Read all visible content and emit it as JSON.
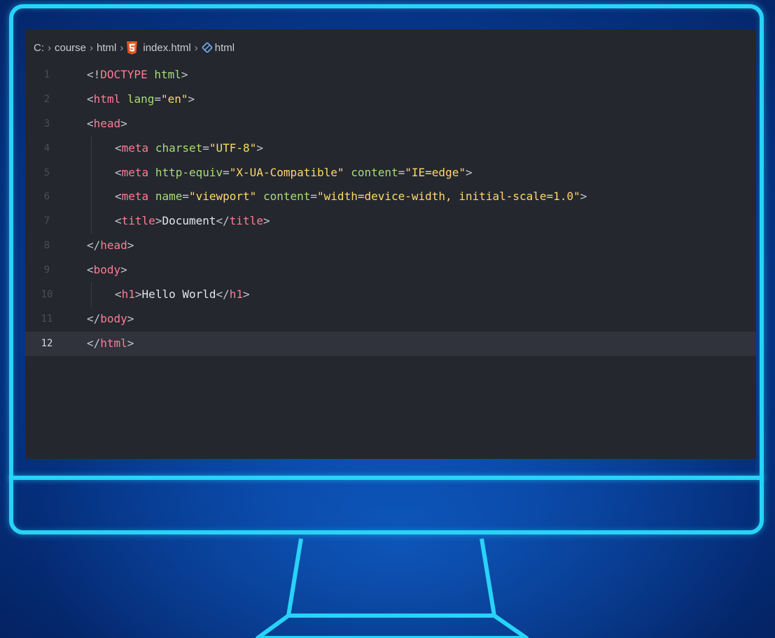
{
  "breadcrumb": {
    "drive": "C:",
    "folder1": "course",
    "folder2": "html",
    "file": "index.html",
    "symbol": "html"
  },
  "editor": {
    "current_line": 12,
    "lines": [
      {
        "n": "1",
        "indent": 0,
        "tokens": [
          [
            "punc",
            "<!"
          ],
          [
            "doc",
            "DOCTYPE"
          ],
          [
            "text",
            " "
          ],
          [
            "kw",
            "html"
          ],
          [
            "punc",
            ">"
          ]
        ]
      },
      {
        "n": "2",
        "indent": 0,
        "tokens": [
          [
            "punc",
            "<"
          ],
          [
            "tag",
            "html"
          ],
          [
            "text",
            " "
          ],
          [
            "kw",
            "lang"
          ],
          [
            "punc",
            "="
          ],
          [
            "str",
            "\"en\""
          ],
          [
            "punc",
            ">"
          ]
        ]
      },
      {
        "n": "3",
        "indent": 0,
        "tokens": [
          [
            "punc",
            "<"
          ],
          [
            "tag",
            "head"
          ],
          [
            "punc",
            ">"
          ]
        ]
      },
      {
        "n": "4",
        "indent": 1,
        "tokens": [
          [
            "punc",
            "<"
          ],
          [
            "tag",
            "meta"
          ],
          [
            "text",
            " "
          ],
          [
            "kw",
            "charset"
          ],
          [
            "punc",
            "="
          ],
          [
            "str",
            "\"UTF-8\""
          ],
          [
            "punc",
            ">"
          ]
        ]
      },
      {
        "n": "5",
        "indent": 1,
        "tokens": [
          [
            "punc",
            "<"
          ],
          [
            "tag",
            "meta"
          ],
          [
            "text",
            " "
          ],
          [
            "kw",
            "http-equiv"
          ],
          [
            "punc",
            "="
          ],
          [
            "str",
            "\"X-UA-Compatible\""
          ],
          [
            "text",
            " "
          ],
          [
            "kw",
            "content"
          ],
          [
            "punc",
            "="
          ],
          [
            "str",
            "\"IE=edge\""
          ],
          [
            "punc",
            ">"
          ]
        ]
      },
      {
        "n": "6",
        "indent": 1,
        "tokens": [
          [
            "punc",
            "<"
          ],
          [
            "tag",
            "meta"
          ],
          [
            "text",
            " "
          ],
          [
            "kw",
            "name"
          ],
          [
            "punc",
            "="
          ],
          [
            "str",
            "\"viewport\""
          ],
          [
            "text",
            " "
          ],
          [
            "kw",
            "content"
          ],
          [
            "punc",
            "="
          ],
          [
            "str",
            "\"width=device-width, initial-scale=1.0\""
          ],
          [
            "punc",
            ">"
          ]
        ]
      },
      {
        "n": "7",
        "indent": 1,
        "tokens": [
          [
            "punc",
            "<"
          ],
          [
            "tag",
            "title"
          ],
          [
            "punc",
            ">"
          ],
          [
            "text",
            "Document"
          ],
          [
            "punc",
            "</"
          ],
          [
            "tag",
            "title"
          ],
          [
            "punc",
            ">"
          ]
        ]
      },
      {
        "n": "8",
        "indent": 0,
        "tokens": [
          [
            "punc",
            "</"
          ],
          [
            "tag",
            "head"
          ],
          [
            "punc",
            ">"
          ]
        ]
      },
      {
        "n": "9",
        "indent": 0,
        "tokens": [
          [
            "punc",
            "<"
          ],
          [
            "tag",
            "body"
          ],
          [
            "punc",
            ">"
          ]
        ]
      },
      {
        "n": "10",
        "indent": 1,
        "tokens": [
          [
            "punc",
            "<"
          ],
          [
            "tag",
            "h1"
          ],
          [
            "punc",
            ">"
          ],
          [
            "text",
            "Hello World"
          ],
          [
            "punc",
            "</"
          ],
          [
            "tag",
            "h1"
          ],
          [
            "punc",
            ">"
          ]
        ]
      },
      {
        "n": "11",
        "indent": 0,
        "tokens": [
          [
            "punc",
            "</"
          ],
          [
            "tag",
            "body"
          ],
          [
            "punc",
            ">"
          ]
        ]
      },
      {
        "n": "12",
        "indent": 0,
        "tokens": [
          [
            "punc",
            "</"
          ],
          [
            "tag",
            "html"
          ],
          [
            "punc",
            ">"
          ]
        ]
      }
    ]
  },
  "colors": {
    "accent_neon": "#27d3f7",
    "editor_bg": "#24272e",
    "tag": "#ff7c93",
    "attribute": "#a9dc76",
    "string": "#ffd866"
  },
  "icons": {
    "file_icon": "html5-icon",
    "symbol_icon": "element-icon"
  }
}
